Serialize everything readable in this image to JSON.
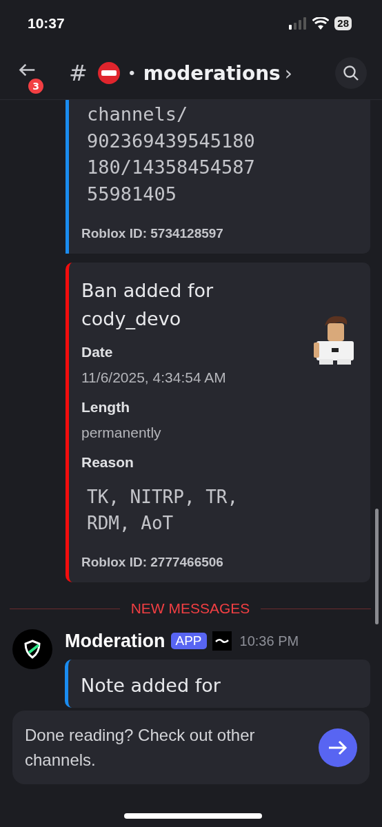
{
  "status_bar": {
    "time": "10:37",
    "battery": "28"
  },
  "header": {
    "back_badge": "3",
    "channel_prefix": "#",
    "separator": "•",
    "channel_name": "moderations",
    "chevron": "›"
  },
  "embeds_before": [
    {
      "color": "#1a8cf0",
      "value_lines": [
        "channels/",
        "902369439545180",
        "180/14358454587",
        "55981405"
      ],
      "footer": "Roblox ID: 5734128597"
    },
    {
      "color": "#f20d0d",
      "title": "Ban added for cody_devo",
      "thumbnail": {
        "kind": "picture"
      },
      "fields": [
        {
          "kind": "text",
          "name": "Date",
          "value": "11/6/2025, 4:34:54 AM"
        },
        {
          "kind": "text",
          "name": "Length",
          "value": "permanently"
        },
        {
          "kind": "code",
          "name": "Reason",
          "value": "TK, NITRP, TR, RDM, AoT"
        }
      ],
      "footer": "Roblox ID: 2777466506"
    }
  ],
  "divider": {
    "label": "NEW MESSAGES"
  },
  "message": {
    "author": "Moderation",
    "tag": "APP",
    "time": "10:36 PM",
    "embed": {
      "color": "#1a8cf0",
      "title": "Note added for"
    }
  },
  "banner": {
    "text": "Done reading? Check out other channels."
  }
}
